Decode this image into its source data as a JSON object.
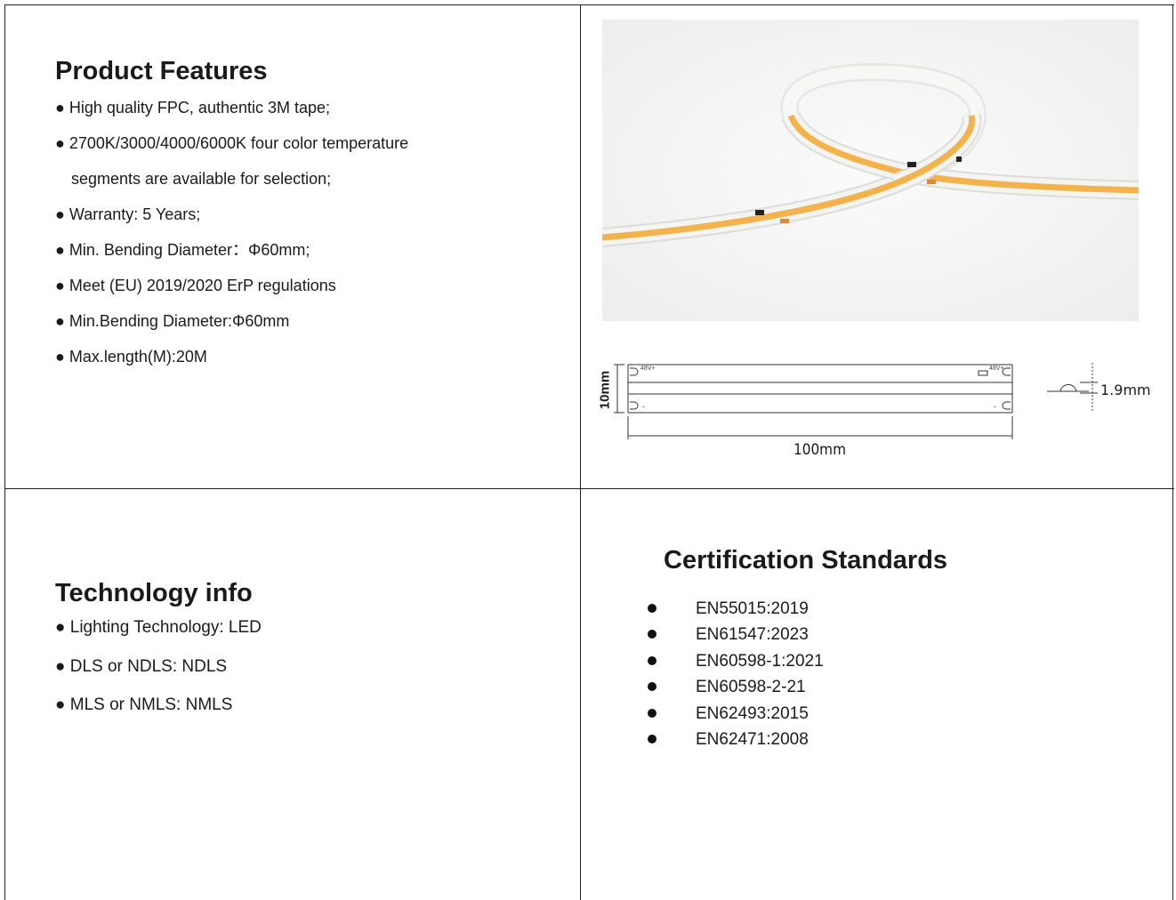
{
  "features": {
    "title": "Product Features",
    "items": [
      "● High quality FPC, authentic 3M tape;",
      "● 2700K/3000/4000/6000K four color temperature",
      "segments are available for selection;",
      "● Warranty: 5 Years;",
      "● Min. Bending Diameter：Φ60mm;",
      "● Meet (EU) 2019/2020 ErP regulations",
      "● Min.Bending Diameter:Φ60mm",
      "● Max.length(M):20M"
    ]
  },
  "drawing": {
    "width_label": "100mm",
    "height_label": "10mm",
    "thickness_label": "1.9mm",
    "voltage_left": "48V+",
    "voltage_right": "48V+",
    "minus": "-"
  },
  "technology": {
    "title": "Technology info",
    "items": [
      "● Lighting Technology: LED",
      "● DLS or NDLS: NDLS",
      "● MLS or NMLS: NMLS"
    ]
  },
  "certification": {
    "title": "Certification Standards",
    "items": [
      "EN55015:2019",
      "EN61547:2023",
      "EN60598-1:2021",
      "EN60598-2-21",
      "EN62493:2015",
      "EN62471:2008"
    ]
  },
  "colors": {
    "led_amber": "#f3b24a",
    "strip_white": "#f4f4f2",
    "border": "#222222"
  }
}
